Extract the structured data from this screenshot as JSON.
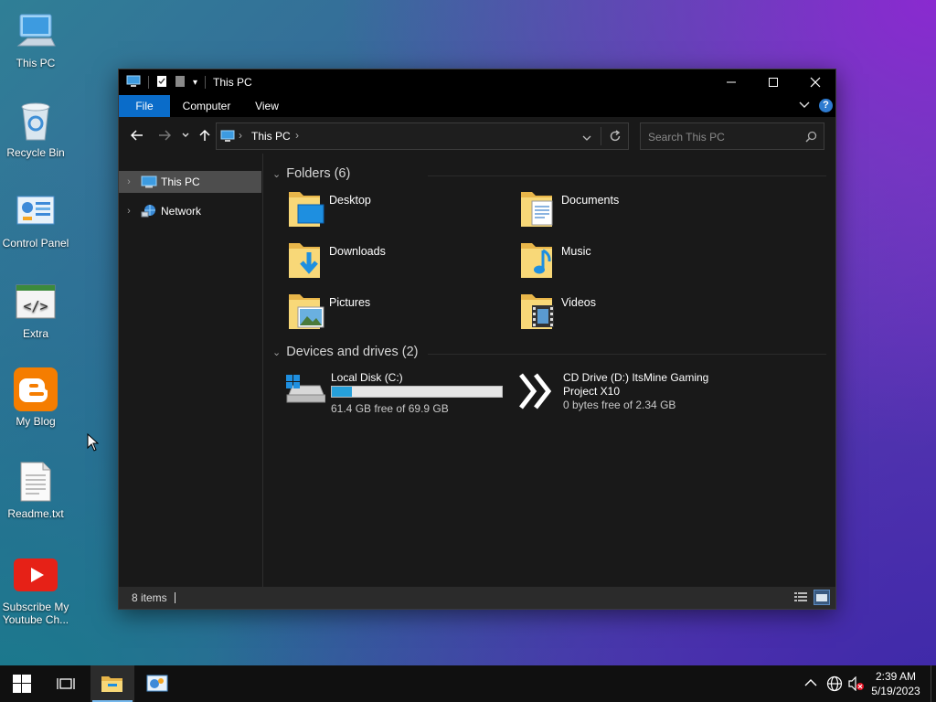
{
  "desktop": {
    "icons": [
      {
        "label": "This PC"
      },
      {
        "label": "Recycle Bin"
      },
      {
        "label": "Control Panel"
      },
      {
        "label": "Extra"
      },
      {
        "label": "My Blog"
      },
      {
        "label": "Readme.txt"
      },
      {
        "label": "Subscribe My Youtube Ch..."
      }
    ]
  },
  "window": {
    "title": "This PC",
    "ribbon_tabs": [
      "File",
      "Computer",
      "View"
    ],
    "address": {
      "segments": [
        "This PC"
      ]
    },
    "search": {
      "placeholder": "Search This PC"
    },
    "nav_pane": [
      {
        "label": "This PC",
        "selected": true
      },
      {
        "label": "Network",
        "selected": false
      }
    ],
    "groups": {
      "folders_header": "Folders (6)",
      "devices_header": "Devices and drives (2)"
    },
    "folders": [
      {
        "name": "Desktop",
        "icon": "desktop-folder-icon"
      },
      {
        "name": "Documents",
        "icon": "documents-folder-icon"
      },
      {
        "name": "Downloads",
        "icon": "downloads-folder-icon"
      },
      {
        "name": "Music",
        "icon": "music-folder-icon"
      },
      {
        "name": "Pictures",
        "icon": "pictures-folder-icon"
      },
      {
        "name": "Videos",
        "icon": "videos-folder-icon"
      }
    ],
    "drives": [
      {
        "name": "Local Disk (C:)",
        "free": "61.4 GB free of 69.9 GB",
        "used_fraction": 0.12
      },
      {
        "name_line1": "CD Drive (D:) ItsMine Gaming",
        "name_line2": "Project X10",
        "free": "0 bytes free of 2.34 GB"
      }
    ],
    "status": {
      "items": "8 items"
    }
  },
  "taskbar": {
    "time": "2:39 AM",
    "date": "5/19/2023"
  },
  "colors": {
    "accent": "#0a6cc9",
    "drive_bar": "#26a0da",
    "taskbar": "#101010"
  }
}
